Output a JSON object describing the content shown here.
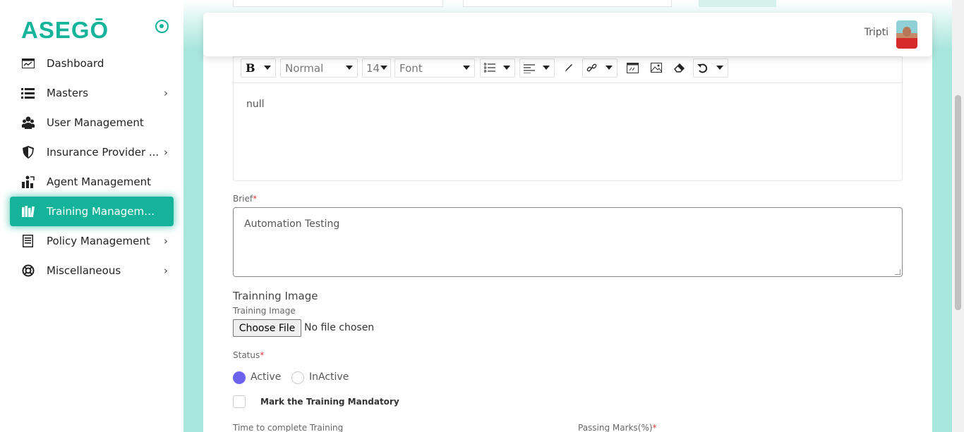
{
  "brand": {
    "logo": "ASEGŌ"
  },
  "user": {
    "name": "Tripti"
  },
  "sidebar": {
    "items": [
      {
        "label": "Dashboard",
        "icon": "dashboard-icon"
      },
      {
        "label": "Masters",
        "icon": "list-icon",
        "chevron": "›"
      },
      {
        "label": "User Management",
        "icon": "users-icon"
      },
      {
        "label": "Insurance Provider ...",
        "icon": "shield-icon",
        "chevron": "›"
      },
      {
        "label": "Agent Management",
        "icon": "agent-icon"
      },
      {
        "label": "Training Management",
        "icon": "books-icon",
        "active": true
      },
      {
        "label": "Policy Management",
        "icon": "document-icon",
        "chevron": "›"
      },
      {
        "label": "Miscellaneous",
        "icon": "lifebuoy-icon",
        "chevron": "›"
      }
    ]
  },
  "editor": {
    "toolbar": {
      "bold": "B",
      "style": "Normal",
      "size": "14",
      "font": "Font"
    },
    "content": "null"
  },
  "form": {
    "brief_label": "Brief",
    "required_mark": "*",
    "brief_value": "Automation Testing",
    "image_alt": "Trainning Image",
    "image_label": "Training Image",
    "file_button": "Choose File",
    "file_status": "No file chosen",
    "status_label": "Status",
    "status_options": [
      "Active",
      "InActive"
    ],
    "status_selected": "Active",
    "mandatory_label": "Mark the Training Mandatory",
    "time_label": "Time to complete Training",
    "passing_label": "Passing Marks(%)"
  },
  "colors": {
    "accent": "#14b39a",
    "radio": "#6c63f0",
    "background": "#a7e6dc"
  }
}
